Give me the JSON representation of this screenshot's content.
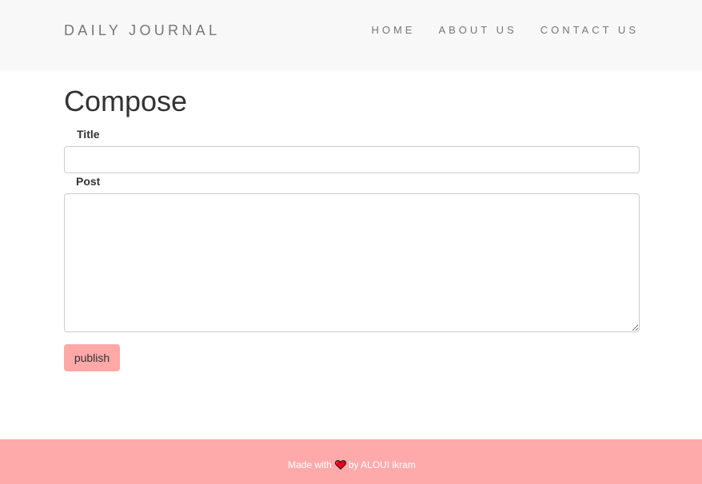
{
  "header": {
    "brand": "DAILY JOURNAL",
    "nav": [
      {
        "label": "HOME"
      },
      {
        "label": "ABOUT US"
      },
      {
        "label": "CONTACT US"
      }
    ]
  },
  "compose": {
    "title": "Compose",
    "title_label": "Title",
    "title_value": "",
    "post_label": "Post",
    "post_value": "",
    "publish_label": "publish"
  },
  "footer": {
    "text_before": "Made with",
    "icon": "heart-icon",
    "text_after": "by ALOUI ikram"
  },
  "colors": {
    "accent": "#ffa8a8",
    "footer_bg": "#ffaaaa",
    "navbar_bg": "#f8f8f8",
    "heart": "#e8001c"
  }
}
